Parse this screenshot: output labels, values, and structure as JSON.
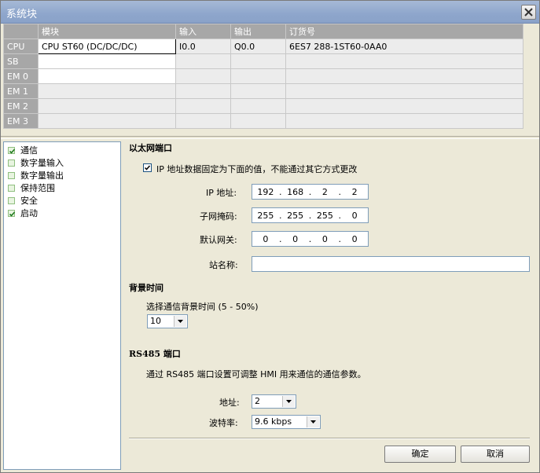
{
  "window": {
    "title": "系统块"
  },
  "module_table": {
    "headers": [
      "",
      "模块",
      "输入",
      "输出",
      "订货号"
    ],
    "rows": [
      [
        "CPU",
        "CPU ST60 (DC/DC/DC)",
        "I0.0",
        "Q0.0",
        "6ES7 288-1ST60-0AA0"
      ],
      [
        "SB",
        "",
        "",
        "",
        ""
      ],
      [
        "EM 0",
        "",
        "",
        "",
        ""
      ],
      [
        "EM 1",
        "",
        "",
        "",
        ""
      ],
      [
        "EM 2",
        "",
        "",
        "",
        ""
      ],
      [
        "EM 3",
        "",
        "",
        "",
        ""
      ]
    ]
  },
  "tree": {
    "items": [
      {
        "label": "通信",
        "checked": true
      },
      {
        "label": "数字量输入",
        "checked": false
      },
      {
        "label": "数字量输出",
        "checked": false
      },
      {
        "label": "保持范围",
        "checked": false
      },
      {
        "label": "安全",
        "checked": false
      },
      {
        "label": "启动",
        "checked": true
      }
    ]
  },
  "ethernet": {
    "title": "以太网端口",
    "fixed_ip_label": "IP 地址数据固定为下面的值，不能通过其它方式更改",
    "fixed_ip_checked": true,
    "ip_label": "IP 地址:",
    "ip": [
      "192",
      "168",
      "2",
      "2"
    ],
    "subnet_label": "子网掩码:",
    "subnet": [
      "255",
      "255",
      "255",
      "0"
    ],
    "gateway_label": "默认网关:",
    "gateway": [
      "0",
      "0",
      "0",
      "0"
    ],
    "station_label": "站名称:",
    "station_value": ""
  },
  "background": {
    "title": "背景时间",
    "desc": "选择通信背景时间 (5 - 50%)",
    "value": "10"
  },
  "rs485": {
    "title": "RS485 端口",
    "desc": "通过 RS485 端口设置可调整 HMI 用来通信的通信参数。",
    "address_label": "地址:",
    "address_value": "2",
    "baud_label": "波特率:",
    "baud_value": "9.6 kbps"
  },
  "buttons": {
    "ok": "确定",
    "cancel": "取消"
  }
}
